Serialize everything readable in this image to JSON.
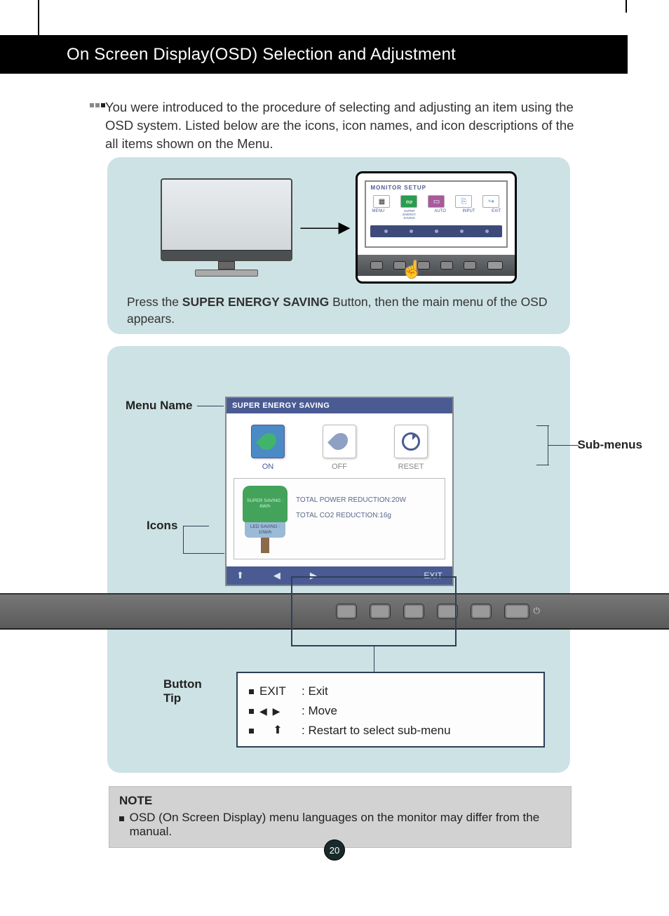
{
  "header": {
    "title": "On Screen Display(OSD) Selection and Adjustment"
  },
  "intro": "You were introduced to the procedure of selecting and adjusting an item using the OSD system. Listed below are the icons, icon names, and icon descriptions of the all items shown on the Menu.",
  "panel1": {
    "popup_title": "MONITOR SETUP",
    "labels": [
      "MENU",
      "SUPER ENERGY SAVING",
      "AUTO",
      "INPUT",
      "EXIT"
    ],
    "caption_pre": "Press the ",
    "caption_bold": "SUPER ENERGY SAVING",
    "caption_post": " Button, then the main menu of the OSD appears."
  },
  "panel2": {
    "labels": {
      "menu_name": "Menu Name",
      "icons": "Icons",
      "sub_menus": "Sub-menus",
      "button_tip": "Button Tip"
    },
    "osd": {
      "title": "SUPER ENERGY SAVING",
      "options": {
        "on": "ON",
        "off": "OFF",
        "reset": "RESET"
      },
      "tree_top": "SUPER SAVING : 6W/h",
      "tree_mid": "LED SAVING : 10W/h",
      "stat1": "TOTAL POWER REDUCTION:20W",
      "stat2": "TOTAL CO2 REDUCTION:16g",
      "nav_exit": "EXIT"
    },
    "tips": {
      "r1_key": "EXIT",
      "r1_desc": ": Exit",
      "r2_desc": ": Move",
      "r3_desc": ": Restart to select sub-menu"
    }
  },
  "note": {
    "title": "NOTE",
    "body": "OSD (On Screen Display) menu languages on the monitor may differ from the manual."
  },
  "page_number": "20"
}
